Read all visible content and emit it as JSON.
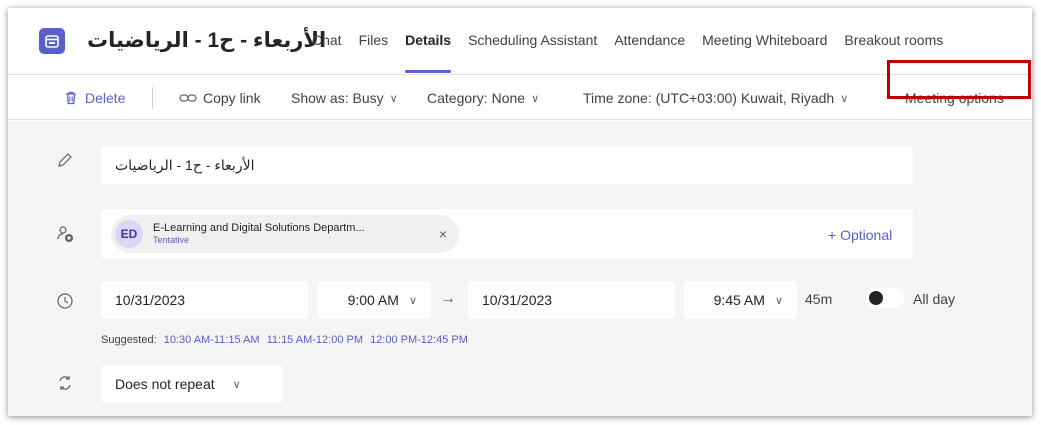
{
  "header": {
    "title": "الأربعاء - ح1 - الرياضيات",
    "app_icon": "calendar-icon",
    "tabs": [
      {
        "label": "Chat"
      },
      {
        "label": "Files"
      },
      {
        "label": "Details",
        "active": true
      },
      {
        "label": "Scheduling Assistant"
      },
      {
        "label": "Attendance"
      },
      {
        "label": "Meeting Whiteboard"
      },
      {
        "label": "Breakout rooms"
      }
    ]
  },
  "toolbar": {
    "delete_label": "Delete",
    "copy_link_label": "Copy link",
    "show_as_label": "Show as: Busy",
    "category_label": "Category: None",
    "time_zone_label": "Time zone: (UTC+03:00) Kuwait, Riyadh",
    "meeting_options_label": "Meeting options"
  },
  "form": {
    "title_value": "الأربعاء - ح1 - الرياضيات",
    "attendee": {
      "initials": "ED",
      "name": "E-Learning and Digital Solutions Departm...",
      "status": "Tentative",
      "remove_glyph": "×"
    },
    "optional_label": "+ Optional",
    "start_date": "10/31/2023",
    "start_time": "9:00 AM",
    "end_date": "10/31/2023",
    "end_time": "9:45 AM",
    "duration": "45m",
    "all_day_label": "All day",
    "all_day_on": false,
    "suggested_label": "Suggested:",
    "suggestions": [
      "10:30 AM-11:15 AM",
      "11:15 AM-12:00 PM",
      "12:00 PM-12:45 PM"
    ],
    "repeat_value": "Does not repeat",
    "arrow_glyph": "→"
  },
  "colors": {
    "accent": "#5b5fc7",
    "highlight_box": "#c00000"
  }
}
